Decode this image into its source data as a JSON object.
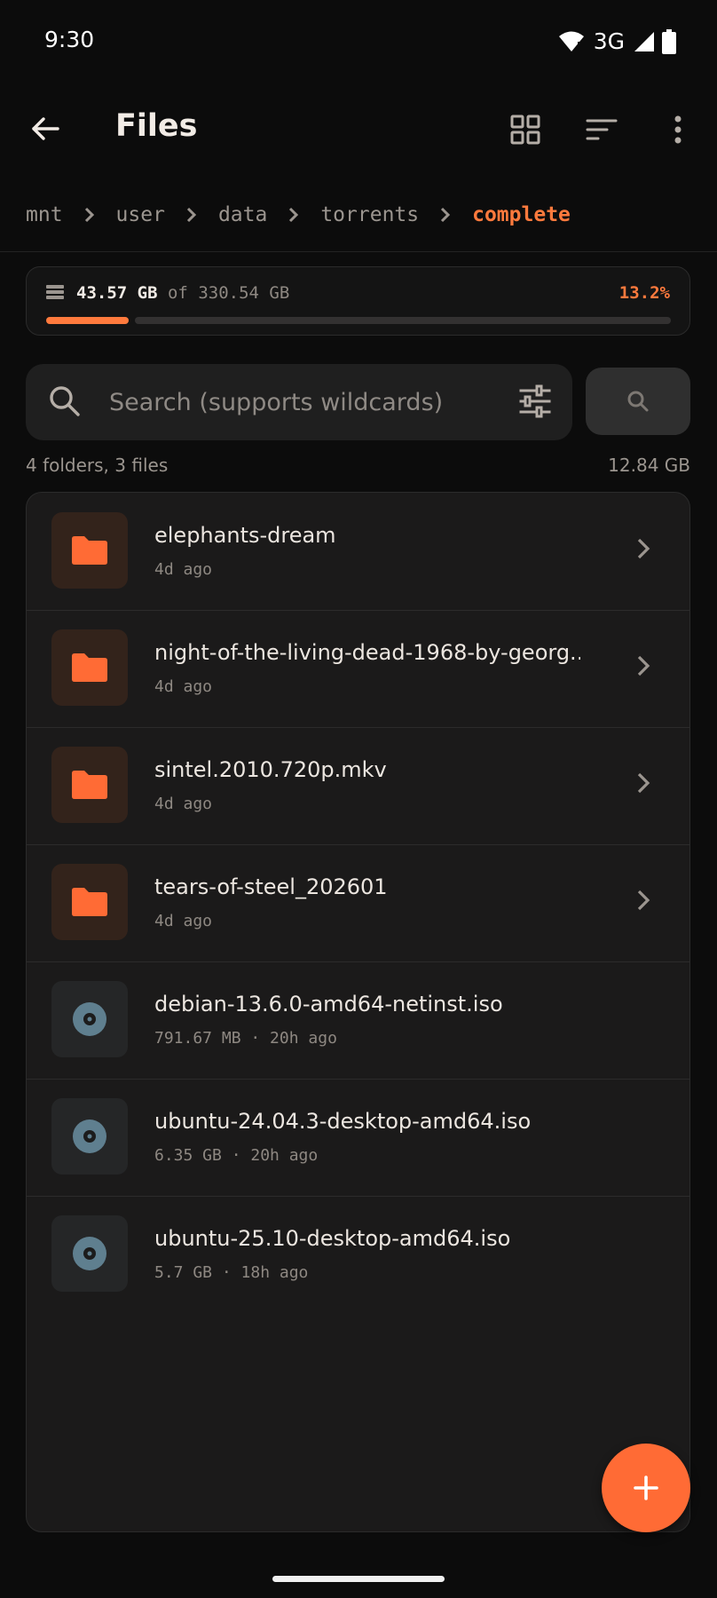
{
  "status_bar": {
    "time": "9:30",
    "network": "3G"
  },
  "app_bar": {
    "title": "Files"
  },
  "breadcrumb": [
    "mnt",
    "user",
    "data",
    "torrents",
    "complete"
  ],
  "storage": {
    "used": "43.57 GB",
    "of_label": "of",
    "total": "330.54 GB",
    "percent": "13.2%",
    "fraction": 0.132
  },
  "search": {
    "placeholder": "Search (supports wildcards)",
    "value": ""
  },
  "summary": {
    "counts": "4 folders, 3 files",
    "total_size": "12.84 GB"
  },
  "files": [
    {
      "name": "elephants-dream",
      "meta": "4d ago",
      "kind": "folder"
    },
    {
      "name": "night-of-the-living-dead-1968-by-georg...",
      "meta": "4d ago",
      "kind": "folder"
    },
    {
      "name": "sintel.2010.720p.mkv",
      "meta": "4d ago",
      "kind": "folder"
    },
    {
      "name": "tears-of-steel_202601",
      "meta": "4d ago",
      "kind": "folder"
    },
    {
      "name": "debian-13.6.0-amd64-netinst.iso",
      "meta": "791.67 MB · 20h ago",
      "kind": "disc"
    },
    {
      "name": "ubuntu-24.04.3-desktop-amd64.iso",
      "meta": "6.35 GB · 20h ago",
      "kind": "disc"
    },
    {
      "name": "ubuntu-25.10-desktop-amd64.iso",
      "meta": "5.7 GB · 18h ago",
      "kind": "disc"
    }
  ],
  "icons": {
    "status": [
      "wifi-icon",
      "signal-icon",
      "battery-icon"
    ],
    "toolbar": [
      "back-arrow-icon",
      "grid-view-icon",
      "sort-icon",
      "more-vert-icon"
    ],
    "folder": "folder-icon",
    "disc": "disc-icon",
    "fab": "plus-icon"
  },
  "colors": {
    "accent": "#ff6b35",
    "background": "#0c0c0c",
    "surface": "#1b1a1a",
    "disc": "#5f7f8f"
  }
}
